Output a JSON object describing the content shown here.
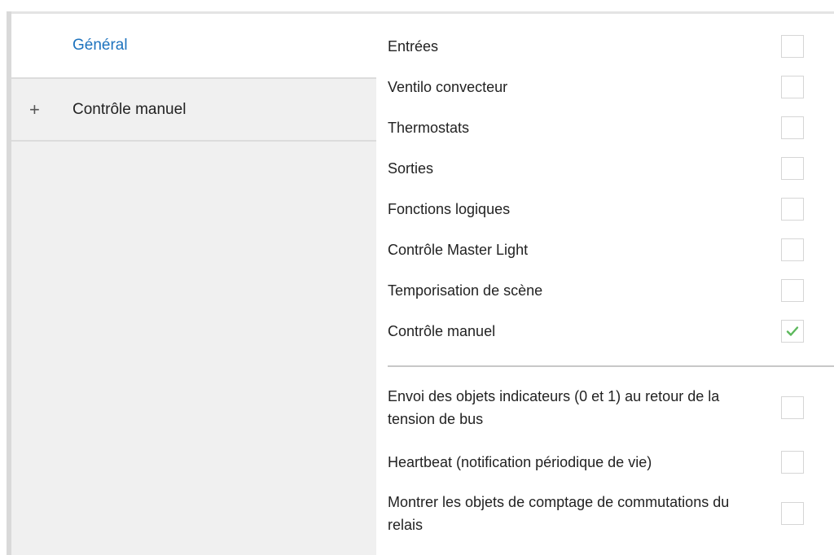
{
  "sidebar": {
    "items": [
      {
        "label": "Général",
        "active": true
      },
      {
        "label": "Contrôle manuel",
        "expand_symbol": "+"
      }
    ]
  },
  "options": [
    {
      "label": "Entrées",
      "checked": false
    },
    {
      "label": "Ventilo convecteur",
      "checked": false
    },
    {
      "label": "Thermostats",
      "checked": false
    },
    {
      "label": "Sorties",
      "checked": false
    },
    {
      "label": "Fonctions logiques",
      "checked": false
    },
    {
      "label": "Contrôle Master Light",
      "checked": false
    },
    {
      "label": "Temporisation de scène",
      "checked": false
    },
    {
      "label": "Contrôle manuel",
      "checked": true
    }
  ],
  "extra_options": [
    {
      "label": "Envoi des objets indicateurs (0 et 1) au retour de la tension de bus",
      "checked": false
    },
    {
      "label": "Heartbeat (notification périodique de vie)",
      "checked": false
    },
    {
      "label": "Montrer les objets de comptage de commutations du relais",
      "checked": false
    }
  ],
  "colors": {
    "accent": "#1e73be",
    "check": "#5cb85c",
    "sidebar_bg": "#f0f0f0"
  }
}
